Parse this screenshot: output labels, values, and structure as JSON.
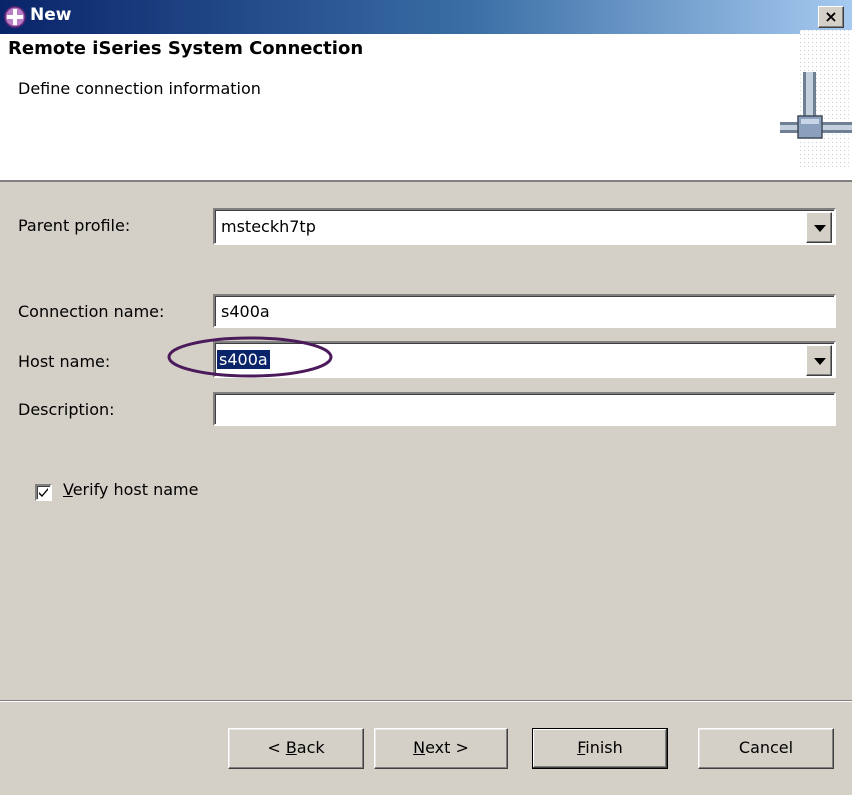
{
  "window": {
    "title": "New",
    "close_label": "×"
  },
  "header": {
    "title": "Remote iSeries System Connection",
    "subtitle": "Define connection information"
  },
  "form": {
    "parent_profile": {
      "label": "Parent profile:",
      "value": "msteckh7tp"
    },
    "connection_name": {
      "label": "Connection name:",
      "value": "s400a"
    },
    "host_name": {
      "label": "Host name:",
      "value": "s400a"
    },
    "description": {
      "label": "Description:",
      "value": ""
    },
    "verify_host": {
      "label_mnemonic": "V",
      "label_rest": "erify host name",
      "checked": true
    }
  },
  "buttons": {
    "back": {
      "pre": "< ",
      "mnemonic": "B",
      "post": "ack"
    },
    "next": {
      "pre": "",
      "mnemonic": "N",
      "post": "ext >"
    },
    "finish": {
      "pre": "",
      "mnemonic": "F",
      "post": "inish"
    },
    "cancel": {
      "label": "Cancel"
    }
  },
  "colors": {
    "titlebar_start": "#0a246a",
    "titlebar_end": "#a6caf0",
    "selection": "#0a246a",
    "annotation_oval": "#4b1a5a",
    "dialog_bg": "#d4d0c8"
  },
  "icons": {
    "title": "wizard-plus-icon",
    "header": "network-connection-icon",
    "close": "close-icon",
    "dropdown": "chevron-down-icon",
    "check": "checkmark-icon"
  }
}
